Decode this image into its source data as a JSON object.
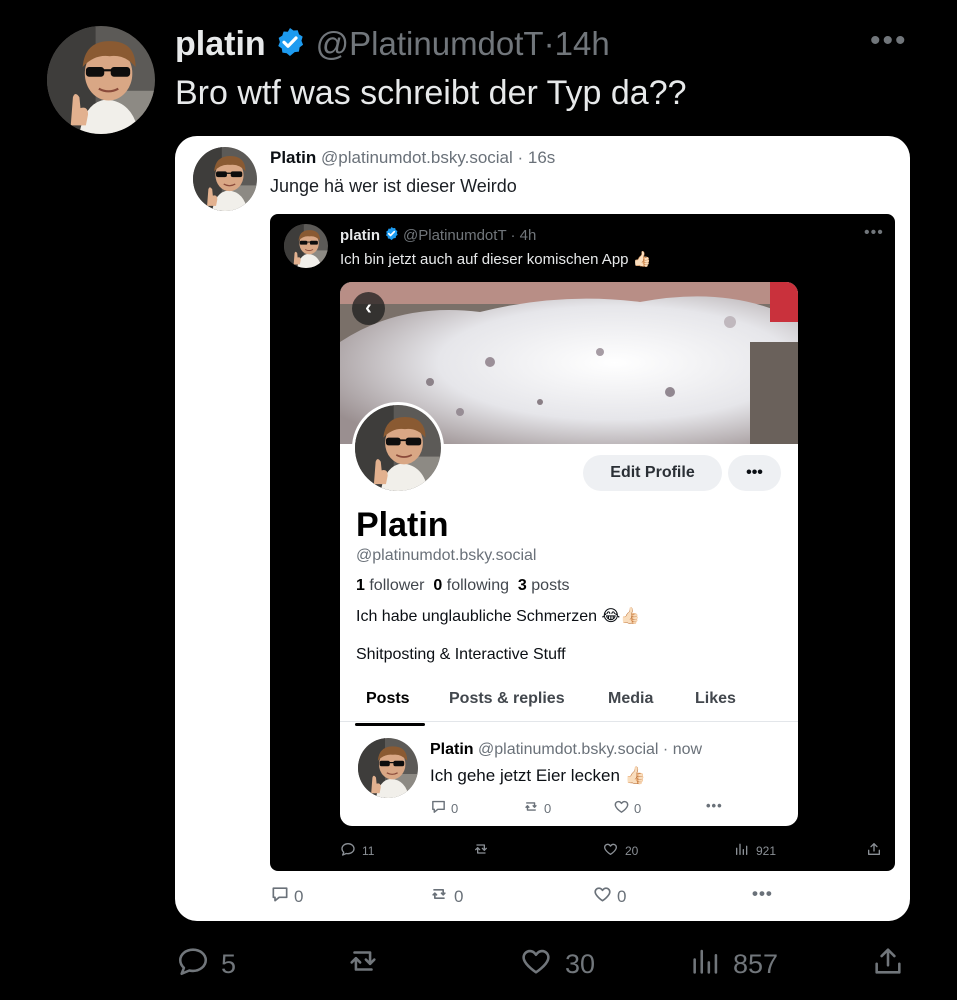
{
  "tweet": {
    "author_name": "platin",
    "handle": "@PlatinumdotT",
    "separator": " · ",
    "time": "14h",
    "text": "Bro wtf was schreibt der Typ da??",
    "more": "•••",
    "actions": {
      "replies": "5",
      "reposts": "",
      "likes": "30",
      "views": "857"
    }
  },
  "bsky_quote": {
    "author_name": "Platin",
    "handle_time": "@platinumdot.bsky.social · 16s",
    "text": "Junge hä wer ist dieser Weirdo",
    "actions": {
      "replies": "0",
      "reposts": "0",
      "likes": "0",
      "more": "•••"
    }
  },
  "embedded_x_post": {
    "author_name": "platin",
    "handle_time": "@PlatinumdotT · 4h",
    "text": "Ich bin jetzt auch auf dieser komischen App 👍🏻",
    "more": "•••",
    "actions": {
      "replies": "11",
      "reposts": "",
      "likes": "20",
      "views": "921"
    }
  },
  "profile": {
    "back_icon": "chevron-left-icon",
    "edit_button": "Edit Profile",
    "more_button": "•••",
    "display_name": "Platin",
    "handle": "@platinumdot.bsky.social",
    "followers_count": "1",
    "followers_label": "follower",
    "following_count": "0",
    "following_label": "following",
    "posts_count": "3",
    "posts_label": "posts",
    "bio": "Ich habe unglaubliche Schmerzen 😂👍🏻",
    "bio_line2": "Shitposting & Interactive Stuff",
    "tabs": [
      "Posts",
      "Posts & replies",
      "Media",
      "Likes"
    ],
    "post": {
      "author_name": "Platin",
      "handle_time": "@platinumdot.bsky.social · now",
      "text": "Ich gehe jetzt Eier lecken 👍🏻",
      "replies": "0",
      "reposts": "0",
      "likes": "0",
      "more": "•••"
    }
  },
  "colors": {
    "background": "#000000",
    "x_text": "#e7e9ea",
    "x_muted": "#71767b",
    "verified_blue": "#1d9bf0",
    "card_bg": "#ffffff"
  }
}
